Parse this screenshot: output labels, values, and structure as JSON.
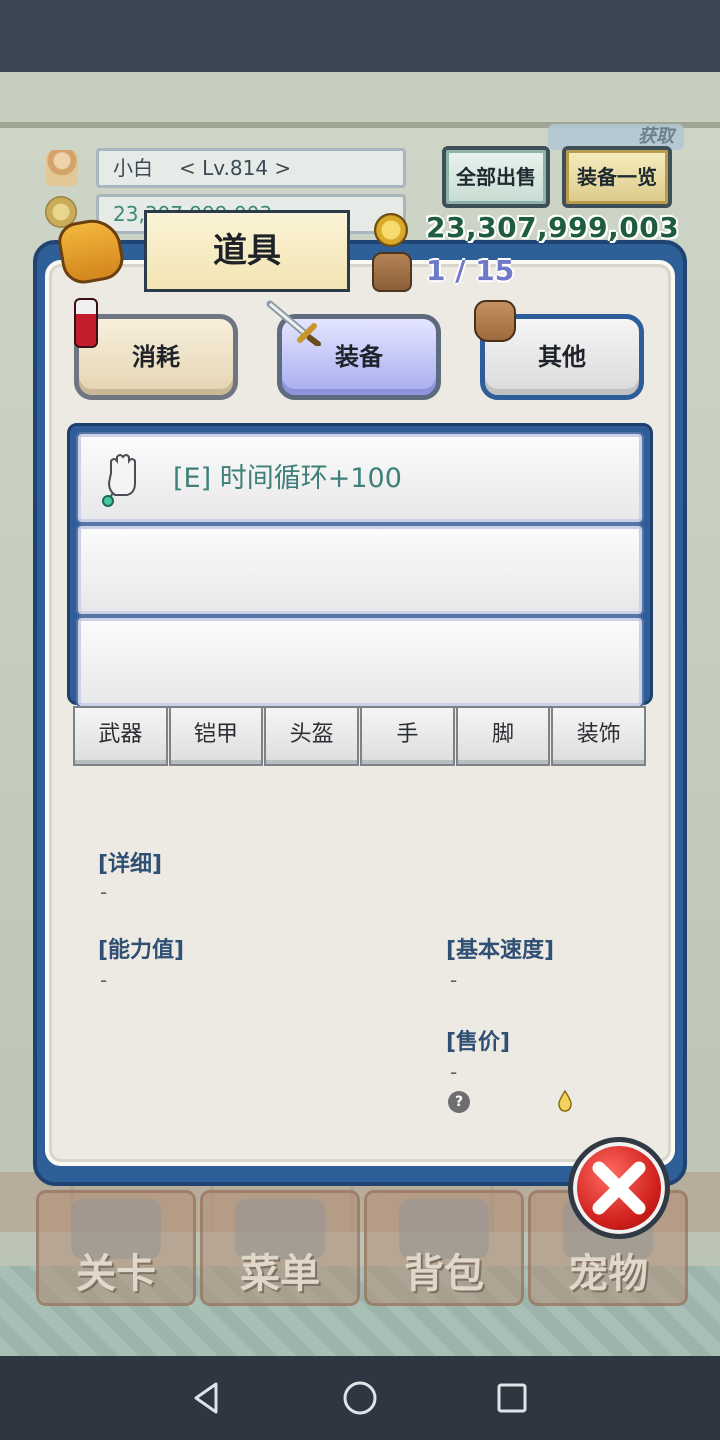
{
  "hud": {
    "player_name": "小白",
    "level": "< Lv.814 >",
    "gold_partial": "23,307,999,003",
    "sell_all_label": "全部出售",
    "equip_list_label": "装备一览",
    "get_label": "获取",
    "gold": "23,307,999,003",
    "bag_count": "1 / 15"
  },
  "panel": {
    "title": "道具",
    "tabs": [
      {
        "label": "消耗"
      },
      {
        "label": "装备"
      },
      {
        "label": "其他"
      }
    ],
    "items": [
      {
        "name": "[E] 时间循环+100"
      },
      {
        "name": ""
      },
      {
        "name": ""
      }
    ],
    "filters": [
      "武器",
      "铠甲",
      "头盔",
      "手",
      "脚",
      "装饰"
    ],
    "detail": {
      "detail_label": "[详细]",
      "detail_value": "-",
      "ability_label": "[能力值]",
      "ability_value": "-",
      "speed_label": "[基本速度]",
      "speed_value": "-",
      "price_label": "[售价]",
      "price_value": "-",
      "question_glyph": "?"
    }
  },
  "bottom_nav": [
    {
      "label": "关卡"
    },
    {
      "label": "菜单"
    },
    {
      "label": "背包"
    },
    {
      "label": "宠物"
    }
  ],
  "colors": {
    "panel_blue": "#2e5f98",
    "item_text": "#3e8079",
    "close_red": "#cf1f1c"
  }
}
